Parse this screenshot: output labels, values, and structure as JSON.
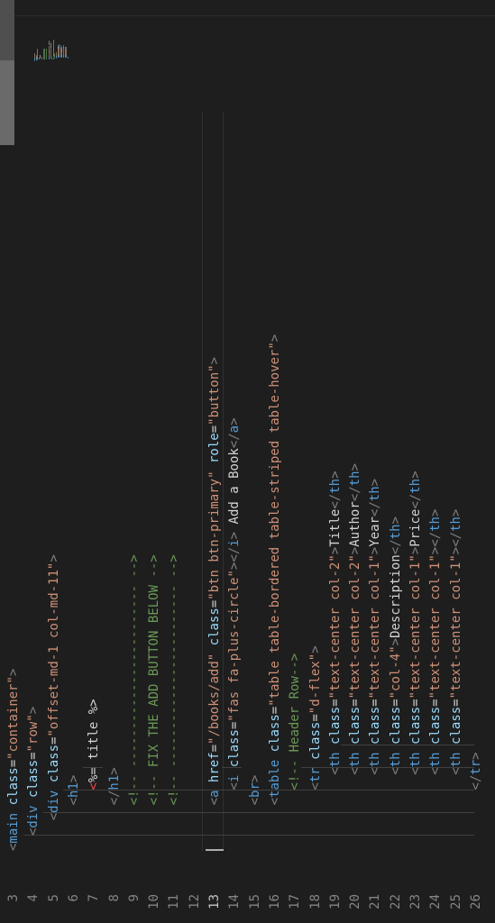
{
  "editor": {
    "line_numbers": [
      "3",
      "4",
      "5",
      "6",
      "7",
      "8",
      "9",
      "10",
      "11",
      "12",
      "13",
      "14",
      "15",
      "16",
      "17",
      "18",
      "19",
      "20",
      "21",
      "22",
      "23",
      "24",
      "25",
      "26"
    ],
    "active_line": "13",
    "lines": [
      [
        [
          "t",
          "<"
        ],
        [
          "n",
          "main"
        ],
        [
          "p",
          " "
        ],
        [
          "a",
          "class"
        ],
        [
          "p",
          "="
        ],
        [
          "s",
          "\"container\""
        ],
        [
          "t",
          ">"
        ]
      ],
      [
        [
          "p",
          "  "
        ],
        [
          "t",
          "<"
        ],
        [
          "n",
          "div"
        ],
        [
          "p",
          " "
        ],
        [
          "a",
          "class"
        ],
        [
          "p",
          "="
        ],
        [
          "s",
          "\"row\""
        ],
        [
          "t",
          ">"
        ]
      ],
      [
        [
          "p",
          "    "
        ],
        [
          "t",
          "<"
        ],
        [
          "n",
          "div"
        ],
        [
          "p",
          " "
        ],
        [
          "a",
          "class"
        ],
        [
          "p",
          "="
        ],
        [
          "s",
          "\"offset-md-1 col-md-11\""
        ],
        [
          "t",
          ">"
        ]
      ],
      [
        [
          "p",
          "      "
        ],
        [
          "t",
          "<"
        ],
        [
          "n",
          "h1"
        ],
        [
          "t",
          ">"
        ]
      ],
      [
        [
          "p",
          "        "
        ],
        [
          "e",
          "<"
        ],
        [
          "p",
          "%= title %>"
        ]
      ],
      [
        [
          "p",
          "      "
        ],
        [
          "t",
          "</"
        ],
        [
          "n",
          "h1"
        ],
        [
          "t",
          ">"
        ]
      ],
      [
        [
          "p",
          "      "
        ],
        [
          "c",
          "<!-- ------------------------ -->"
        ]
      ],
      [
        [
          "p",
          "      "
        ],
        [
          "c",
          "<!-- FIX THE ADD BUTTON BELOW -->"
        ]
      ],
      [
        [
          "p",
          "      "
        ],
        [
          "c",
          "<!-- ------------------------ -->"
        ]
      ],
      [
        [
          "p",
          ""
        ]
      ],
      [
        [
          "p",
          "      "
        ],
        [
          "t",
          "<"
        ],
        [
          "n",
          "a"
        ],
        [
          "p",
          " "
        ],
        [
          "a",
          "href"
        ],
        [
          "p",
          "="
        ],
        [
          "s",
          "\"/books/add\""
        ],
        [
          "p",
          " "
        ],
        [
          "a",
          "class"
        ],
        [
          "p",
          "="
        ],
        [
          "s",
          "\"btn btn-primary\""
        ],
        [
          "p",
          " "
        ],
        [
          "a",
          "role"
        ],
        [
          "p",
          "="
        ],
        [
          "s",
          "\"button\""
        ],
        [
          "t",
          ">"
        ]
      ],
      [
        [
          "p",
          "        "
        ],
        [
          "t",
          "<"
        ],
        [
          "n",
          "i"
        ],
        [
          "p",
          " "
        ],
        [
          "a",
          "class"
        ],
        [
          "p",
          "="
        ],
        [
          "s",
          "\"fas fa-plus-circle\""
        ],
        [
          "t",
          "></"
        ],
        [
          "n",
          "i"
        ],
        [
          "t",
          ">"
        ],
        [
          "p",
          " Add a Book"
        ],
        [
          "t",
          "</"
        ],
        [
          "n",
          "a"
        ],
        [
          "t",
          ">"
        ]
      ],
      [
        [
          "p",
          "      "
        ],
        [
          "t",
          "<"
        ],
        [
          "n",
          "br"
        ],
        [
          "t",
          ">"
        ]
      ],
      [
        [
          "p",
          "      "
        ],
        [
          "t",
          "<"
        ],
        [
          "n",
          "table"
        ],
        [
          "p",
          " "
        ],
        [
          "a",
          "class"
        ],
        [
          "p",
          "="
        ],
        [
          "s",
          "\"table table-bordered table-striped table-hover\""
        ],
        [
          "t",
          ">"
        ]
      ],
      [
        [
          "p",
          "        "
        ],
        [
          "c",
          "<!-- Header Row-->"
        ]
      ],
      [
        [
          "p",
          "        "
        ],
        [
          "t",
          "<"
        ],
        [
          "n",
          "tr"
        ],
        [
          "p",
          " "
        ],
        [
          "a",
          "class"
        ],
        [
          "p",
          "="
        ],
        [
          "s",
          "\"d-flex\""
        ],
        [
          "t",
          ">"
        ]
      ],
      [
        [
          "p",
          "          "
        ],
        [
          "t",
          "<"
        ],
        [
          "n",
          "th"
        ],
        [
          "p",
          " "
        ],
        [
          "a",
          "class"
        ],
        [
          "p",
          "="
        ],
        [
          "s",
          "\"text-center col-2\""
        ],
        [
          "t",
          ">"
        ],
        [
          "p",
          "Title"
        ],
        [
          "t",
          "</"
        ],
        [
          "n",
          "th"
        ],
        [
          "t",
          ">"
        ]
      ],
      [
        [
          "p",
          "          "
        ],
        [
          "t",
          "<"
        ],
        [
          "n",
          "th"
        ],
        [
          "p",
          " "
        ],
        [
          "a",
          "class"
        ],
        [
          "p",
          "="
        ],
        [
          "s",
          "\"text-center col-2\""
        ],
        [
          "t",
          ">"
        ],
        [
          "p",
          "Author"
        ],
        [
          "t",
          "</"
        ],
        [
          "n",
          "th"
        ],
        [
          "t",
          ">"
        ]
      ],
      [
        [
          "p",
          "          "
        ],
        [
          "t",
          "<"
        ],
        [
          "n",
          "th"
        ],
        [
          "p",
          " "
        ],
        [
          "a",
          "class"
        ],
        [
          "p",
          "="
        ],
        [
          "s",
          "\"text-center col-1\""
        ],
        [
          "t",
          ">"
        ],
        [
          "p",
          "Year"
        ],
        [
          "t",
          "</"
        ],
        [
          "n",
          "th"
        ],
        [
          "t",
          ">"
        ]
      ],
      [
        [
          "p",
          "          "
        ],
        [
          "t",
          "<"
        ],
        [
          "n",
          "th"
        ],
        [
          "p",
          " "
        ],
        [
          "a",
          "class"
        ],
        [
          "p",
          "="
        ],
        [
          "s",
          "\"col-4\""
        ],
        [
          "t",
          ">"
        ],
        [
          "p",
          "Description"
        ],
        [
          "t",
          "</"
        ],
        [
          "n",
          "th"
        ],
        [
          "t",
          ">"
        ]
      ],
      [
        [
          "p",
          "          "
        ],
        [
          "t",
          "<"
        ],
        [
          "n",
          "th"
        ],
        [
          "p",
          " "
        ],
        [
          "a",
          "class"
        ],
        [
          "p",
          "="
        ],
        [
          "s",
          "\"text-center col-1\""
        ],
        [
          "t",
          ">"
        ],
        [
          "p",
          "Price"
        ],
        [
          "t",
          "</"
        ],
        [
          "n",
          "th"
        ],
        [
          "t",
          ">"
        ]
      ],
      [
        [
          "p",
          "          "
        ],
        [
          "t",
          "<"
        ],
        [
          "n",
          "th"
        ],
        [
          "p",
          " "
        ],
        [
          "a",
          "class"
        ],
        [
          "p",
          "="
        ],
        [
          "s",
          "\"text-center col-1\""
        ],
        [
          "t",
          "></"
        ],
        [
          "n",
          "th"
        ],
        [
          "t",
          ">"
        ]
      ],
      [
        [
          "p",
          "          "
        ],
        [
          "t",
          "<"
        ],
        [
          "n",
          "th"
        ],
        [
          "p",
          " "
        ],
        [
          "a",
          "class"
        ],
        [
          "p",
          "="
        ],
        [
          "s",
          "\"text-center col-1\""
        ],
        [
          "t",
          "></"
        ],
        [
          "n",
          "th"
        ],
        [
          "t",
          ">"
        ]
      ],
      [
        [
          "p",
          "        "
        ],
        [
          "t",
          "</"
        ],
        [
          "n",
          "tr"
        ],
        [
          "t",
          ">"
        ]
      ]
    ]
  }
}
